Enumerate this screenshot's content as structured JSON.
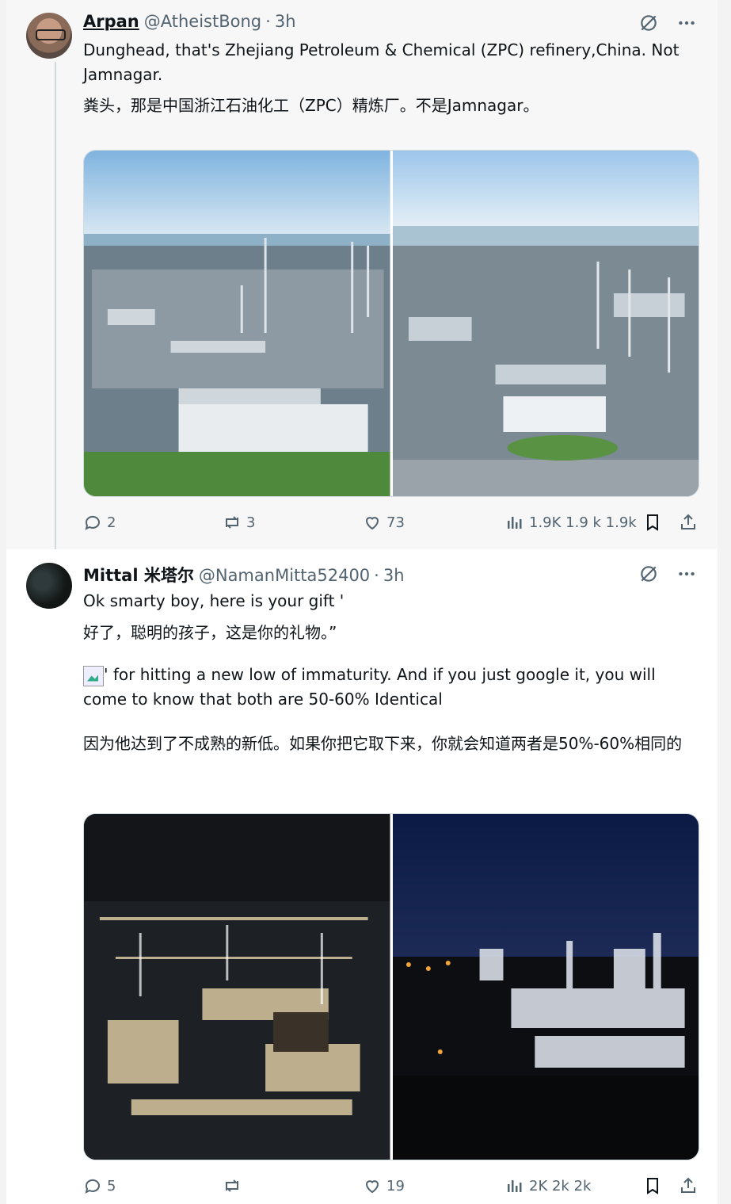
{
  "tweets": [
    {
      "name": "Arpan",
      "handle": "@AtheistBong",
      "dot": "·",
      "time": "3h",
      "text_en": "Dunghead, that's Zhejiang Petroleum & Chemical (ZPC) refinery,China. Not Jamnagar.",
      "text_zh": "粪头，那是中国浙江石油化工（ZPC）精炼厂。不是Jamnagar。",
      "images": [
        "refinery-day-left",
        "refinery-day-right"
      ],
      "replies": "2",
      "reposts": "3",
      "likes": "73",
      "views": "1.9K 1.9 k 1.9k"
    },
    {
      "name": "Mittal 米塔尔",
      "handle": "@NamanMitta52400",
      "dot": "·",
      "time": "3h",
      "text_en": "Ok smarty boy, here is your gift '",
      "text_zh": "好了，聪明的孩子，这是你的礼物。”",
      "text_en2": "' for hitting a new low of immaturity. And if you just google it, you will come to know that both are 50-60% Identical",
      "text_zh2": "因为他达到了不成熟的新低。如果你把它取下来，你就会知道两者是50%-60%相同的",
      "images": [
        "refinery-night-left",
        "refinery-night-right"
      ],
      "replies": "5",
      "reposts": "",
      "likes": "19",
      "views": "2K 2k 2k"
    }
  ],
  "icons": {
    "grok": "grok-icon",
    "more": "more-icon",
    "reply": "reply-icon",
    "repost": "repost-icon",
    "like": "heart-icon",
    "views": "views-icon",
    "bookmark": "bookmark-icon",
    "share": "share-icon"
  },
  "colors": {
    "secondary_text": "#536471",
    "border": "#cfd9de"
  }
}
